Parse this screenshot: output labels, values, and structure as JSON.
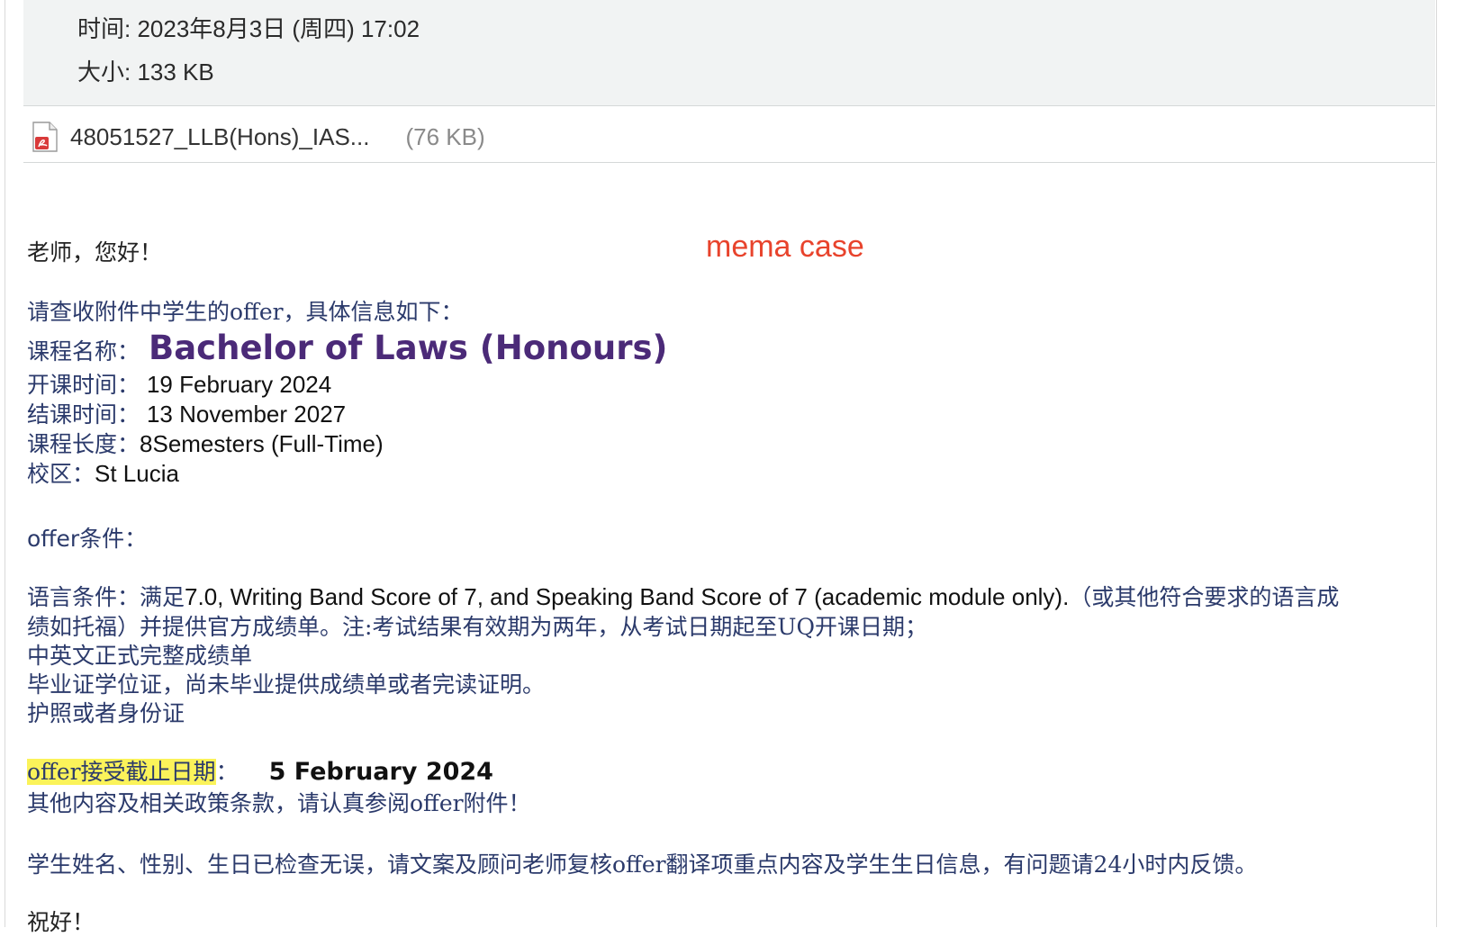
{
  "header": {
    "time": "时间: 2023年8月3日 (周四) 17:02",
    "size": "大小: 133 KB"
  },
  "attachment": {
    "name": "48051527_LLB(Hons)_IAS...",
    "size": "(76 KB)",
    "icon": "pdf-file-icon"
  },
  "watermark": "mema case",
  "email": {
    "greeting": "老师，您好！",
    "intro": "请查收附件中学生的offer，具体信息如下：",
    "course_label": "课程名称：",
    "course_name": "Bachelor of Laws (Honours)",
    "start_label": "开课时间：",
    "start_date": "19 February 2024",
    "end_label": "结课时间：",
    "end_date": "13 November 2027",
    "length_label": "课程长度：",
    "length_value": "8Semesters (Full-Time)",
    "campus_label": "校区：",
    "campus_value": "St Lucia",
    "conditions_heading": "offer条件：",
    "language_label": "语言条件：满足",
    "language_en": "7.0, Writing Band Score of 7, and Speaking Band Score of 7 (academic module only).",
    "language_cn_tail": "（或其他符合要求的语言成",
    "language_cont": "绩如托福）并提供官方成绩单。注:考试结果有效期为两年，从考试日期起至UQ开课日期；",
    "doc_transcript": "中英文正式完整成绩单",
    "doc_degree": "毕业证学位证，尚未毕业提供成绩单或者完读证明。",
    "doc_id": "护照或者身份证",
    "deadline_label": "offer接受截止日期",
    "deadline_colon": "：",
    "deadline_value": "5 February 2024",
    "policy_note": "其他内容及相关政策条款，请认真参阅offer附件！",
    "check_note": "学生姓名、性别、生日已检查无误，请文案及顾问老师复核offer翻译项重点内容及学生生日信息，有问题请24小时内反馈。",
    "closing": "祝好！"
  },
  "colors": {
    "header_bg": "#f1f3f3",
    "body_text": "#2b3a6b",
    "course_name": "#4b2a78",
    "watermark": "#e8432c",
    "highlight": "#fbf35a"
  }
}
